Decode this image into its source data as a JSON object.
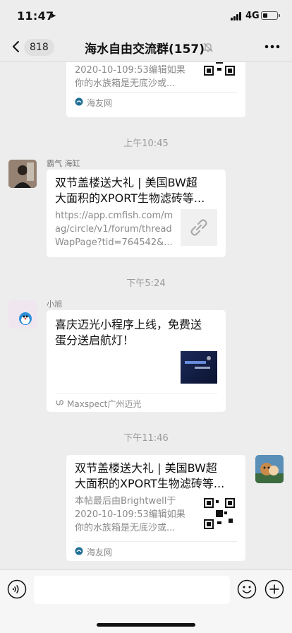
{
  "status_bar": {
    "time": "11:47",
    "location_glyph": "➤",
    "network": "4G",
    "battery_level": 0.35
  },
  "nav": {
    "back_count": "818",
    "title": "海水自由交流群(157)",
    "icons": [
      "chevron-left-icon",
      "mute-bell-icon",
      "more-dots-icon"
    ]
  },
  "messages": [
    {
      "type": "link-card",
      "side": "right",
      "title": "",
      "desc": [
        "2020-10-109:53编辑如果",
        "你的水族箱是无底沙或..."
      ],
      "source": "海友网",
      "thumb": "qr-code-thumb"
    },
    {
      "type": "timestamp",
      "text": "上午10:45"
    },
    {
      "type": "link-card",
      "side": "left",
      "sender": "霸气 海缸",
      "title": [
        "双节盖楼送大礼 | 美国BW超",
        "大面积的XPORT生物滤砖等..."
      ],
      "desc": [
        "https://app.cmfish.com/m",
        "ag/circle/v1/forum/thread",
        "WapPage?tid=764542&..."
      ],
      "thumb": "link-icon"
    },
    {
      "type": "timestamp",
      "text": "下午5:24"
    },
    {
      "type": "miniprogram-card",
      "side": "left",
      "sender": "小旭",
      "title": [
        "喜庆迈光小程序上线，免费送",
        "蛋分送启航灯！"
      ],
      "source": "Maxspect广州迈光",
      "thumb": "product-image-thumb"
    },
    {
      "type": "timestamp",
      "text": "下午11:46"
    },
    {
      "type": "link-card",
      "side": "right",
      "title": [
        "双节盖楼送大礼 | 美国BW超",
        "大面积的XPORT生物滤砖等..."
      ],
      "desc": [
        "本帖最后由Brightwell于",
        "2020-10-109:53编辑如果",
        "你的水族箱是无底沙或..."
      ],
      "source": "海友网",
      "thumb": "qr-code-thumb"
    }
  ],
  "input_bar": {
    "placeholder": "",
    "icons": [
      "voice-icon",
      "emoji-icon",
      "plus-icon"
    ]
  },
  "colors": {
    "background": "#ededed",
    "card": "#ffffff",
    "meta_text": "#999999"
  }
}
